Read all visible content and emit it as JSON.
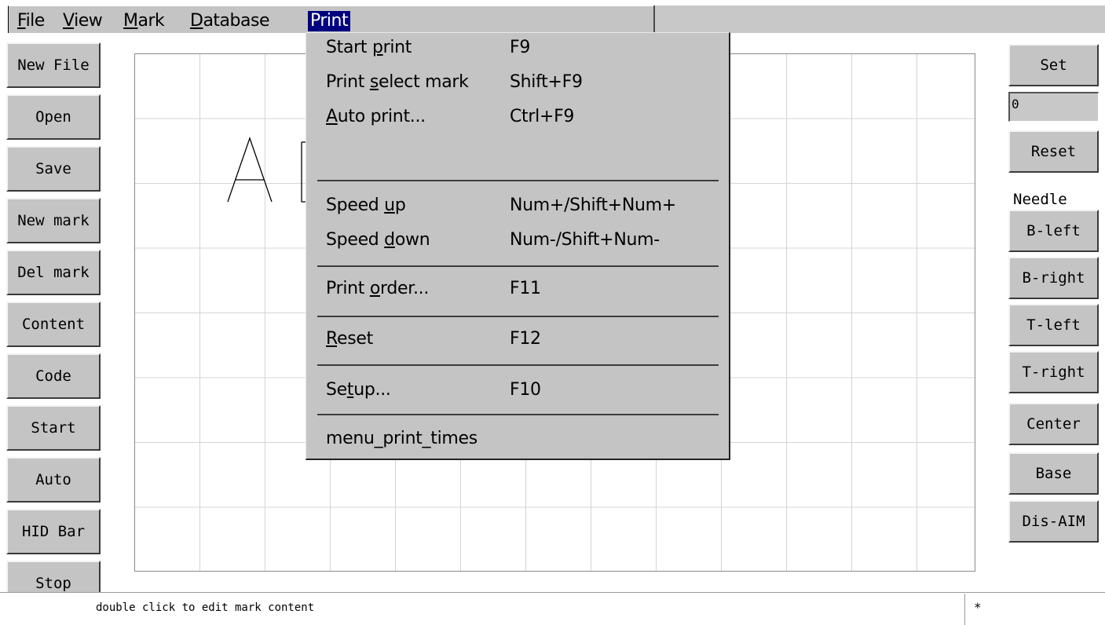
{
  "menubar": {
    "items": [
      {
        "label": "File",
        "ul": 0
      },
      {
        "label": "View",
        "ul": 0
      },
      {
        "label": "Mark",
        "ul": 0
      },
      {
        "label": "Database",
        "ul": 0
      },
      {
        "label": "Print",
        "ul": -1
      }
    ]
  },
  "left_buttons": [
    "New File",
    "Open",
    "Save",
    "New mark",
    "Del mark",
    "Content",
    "Code",
    "Start",
    "Auto",
    "HID Bar",
    "Stop"
  ],
  "right_panel": {
    "set_label": "Set",
    "counter_value": "0",
    "reset_label": "Reset",
    "needle_label": "Needle",
    "buttons": [
      "B-left",
      "B-right",
      "T-left",
      "T-right",
      "Center",
      "Base",
      "Dis-AIM"
    ]
  },
  "canvas": {
    "mark_text_visible": "A"
  },
  "print_menu": {
    "items": [
      {
        "label": "Start print",
        "ul": 6,
        "shortcut": "F9"
      },
      {
        "label": "Print select mark",
        "ul": 6,
        "shortcut": "Shift+F9"
      },
      {
        "label": "Auto print...",
        "ul": 0,
        "shortcut": "Ctrl+F9"
      },
      {
        "label": "Speed up",
        "ul": 6,
        "shortcut": "Num+/Shift+Num+"
      },
      {
        "label": "Speed down",
        "ul": 6,
        "shortcut": "Num-/Shift+Num-"
      },
      {
        "label": "Print order...",
        "ul": 6,
        "shortcut": "F11"
      },
      {
        "label": "Reset",
        "ul": 0,
        "shortcut": "F12"
      },
      {
        "label": "Setup...",
        "ul": 2,
        "shortcut": "F10"
      },
      {
        "label": "menu_print_times",
        "ul": -1,
        "shortcut": ""
      }
    ]
  },
  "statusbar": {
    "hint": "double click to edit mark content",
    "indicator": "*"
  },
  "colors": {
    "menu_highlight": "#000080",
    "panel_gray": "#c4c4c4",
    "grid_line": "#d4d4d4"
  }
}
